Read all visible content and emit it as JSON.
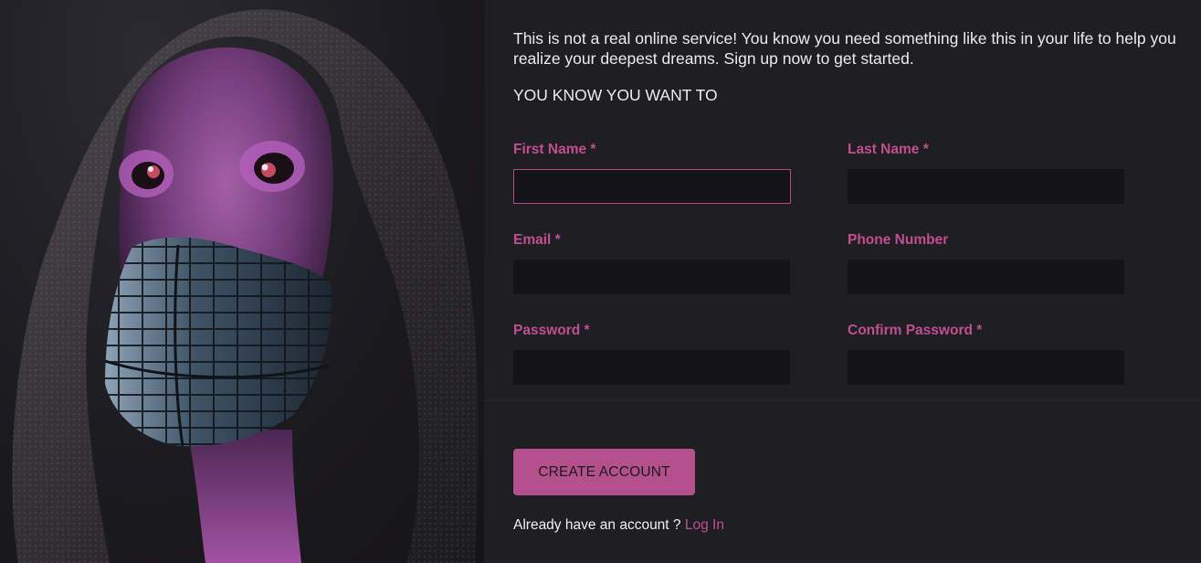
{
  "intro": {
    "text": "This is not a real online service! You know you need something like this in your life to help you realize your deepest dreams. Sign up now to get started.",
    "tagline": "YOU KNOW YOU WANT TO"
  },
  "form": {
    "first_name": {
      "label": "First Name *",
      "value": "",
      "placeholder": ""
    },
    "last_name": {
      "label": "Last Name *",
      "value": "",
      "placeholder": ""
    },
    "email": {
      "label": "Email *",
      "value": "",
      "placeholder": ""
    },
    "phone": {
      "label": "Phone Number",
      "value": "",
      "placeholder": ""
    },
    "password": {
      "label": "Password *",
      "value": "",
      "placeholder": ""
    },
    "confirm_password": {
      "label": "Confirm Password *",
      "value": "",
      "placeholder": ""
    }
  },
  "actions": {
    "create_account_label": "CREATE ACCOUNT",
    "login_prompt": "Already have an account ? ",
    "login_link": "Log In"
  },
  "colors": {
    "accent": "#b4508c",
    "label": "#c04f91",
    "background": "#1f1e23",
    "input_background": "#141317",
    "text": "#ecebef"
  },
  "illustration": {
    "description_icon": "hooded-masked-figure-illustration"
  }
}
